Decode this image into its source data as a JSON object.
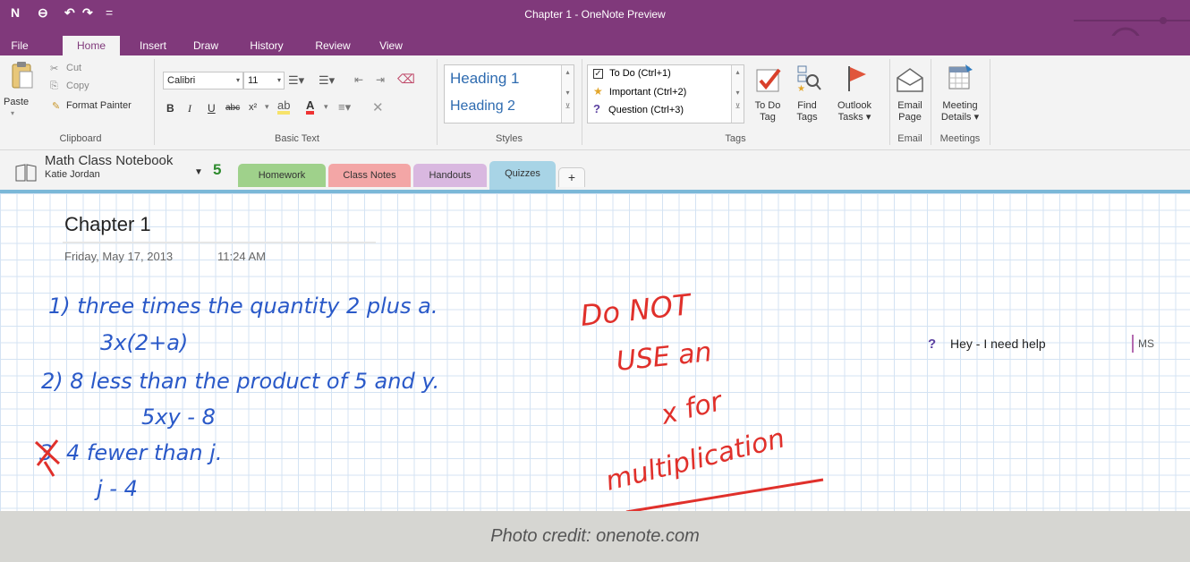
{
  "app": {
    "title": "Chapter 1 - OneNote Preview",
    "quick_access": [
      "N",
      "⊖",
      "↶",
      "↷",
      "="
    ]
  },
  "ribbon_tabs": [
    "File",
    "Home",
    "Insert",
    "Draw",
    "History",
    "Review",
    "View"
  ],
  "active_tab": "Home",
  "clipboard": {
    "paste": "Paste",
    "cut": "Cut",
    "copy": "Copy",
    "format_painter": "Format Painter",
    "group_label": "Clipboard"
  },
  "basic_text": {
    "font": "Calibri",
    "size": "11",
    "bold": "B",
    "italic": "I",
    "underline": "U",
    "strike": "abc",
    "superscript": "x²",
    "group_label": "Basic Text"
  },
  "styles": {
    "heading1": "Heading 1",
    "heading2": "Heading 2",
    "group_label": "Styles"
  },
  "tags": {
    "items": [
      {
        "label": "To Do (Ctrl+1)"
      },
      {
        "label": "Important (Ctrl+2)"
      },
      {
        "label": "Question (Ctrl+3)"
      }
    ],
    "todo_tag_line1": "To Do",
    "todo_tag_line2": "Tag",
    "find_tags_line1": "Find",
    "find_tags_line2": "Tags",
    "outlook_line1": "Outlook",
    "outlook_line2": "Tasks ▾",
    "group_label": "Tags"
  },
  "email": {
    "line1": "Email",
    "line2": "Page",
    "group_label": "Email"
  },
  "meetings": {
    "line1": "Meeting",
    "line2": "Details ▾",
    "group_label": "Meetings"
  },
  "notebook": {
    "name": "Math Class Notebook",
    "owner": "Katie Jordan",
    "back_arrow": "5"
  },
  "section_tabs": [
    {
      "label": "Homework",
      "color": "#9fd18b"
    },
    {
      "label": "Class Notes",
      "color": "#f3a6a6"
    },
    {
      "label": "Handouts",
      "color": "#d9b8e0"
    },
    {
      "label": "Quizzes",
      "color": "#a8d4e6"
    },
    {
      "label": "+",
      "color": "#f3f3f3"
    }
  ],
  "page": {
    "title": "Chapter 1",
    "date": "Friday, May 17, 2013",
    "time": "11:24 AM",
    "handwriting": {
      "line1": "1) three times the quantity 2 plus a.",
      "line2": "3x(2+a)",
      "line3": "2) 8 less than the product of 5 and y.",
      "line4": "5xy - 8",
      "line5": "4 fewer than j.",
      "line6": "j - 4",
      "red1": "Do NOT",
      "red2": "USE an",
      "red3": "x for",
      "red4": "multiplication"
    },
    "question_mark": "?",
    "help_note": "Hey - I need help",
    "help_initials": "MS"
  },
  "caption": "Photo credit: onenote.com",
  "colors": {
    "accent": "#80397b",
    "ink_blue": "#2a59c8",
    "ink_red": "#e0302b",
    "grid": "#d4e3f3"
  }
}
